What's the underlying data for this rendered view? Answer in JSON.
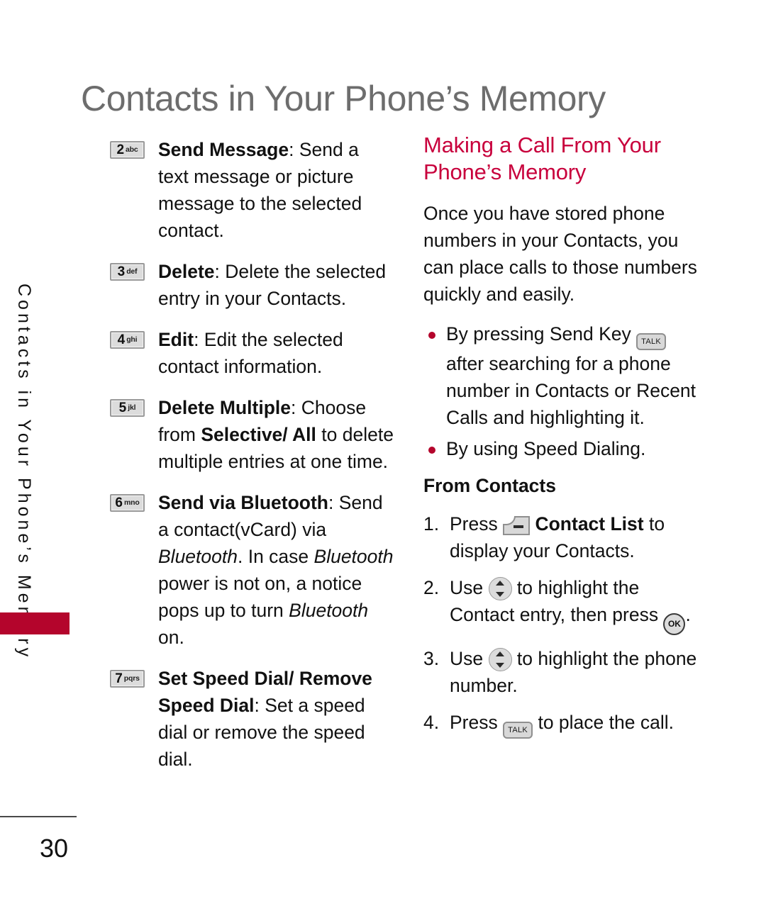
{
  "page": {
    "title": "Contacts in Your Phone’s Memory",
    "side_tab_label": "Contacts in Your Phone’s Memory",
    "number": "30",
    "accent_red": "#b4052c",
    "heading_red": "#c8003c",
    "title_gray": "#6d6d6d"
  },
  "left_column": {
    "items": [
      {
        "key_number": "2",
        "key_letters": "abc",
        "icon": "keypad-key-2-icon",
        "title": "Send Message",
        "body": ": Send a text message or picture message to the selected contact."
      },
      {
        "key_number": "3",
        "key_letters": "def",
        "icon": "keypad-key-3-icon",
        "title": "Delete",
        "body": ": Delete the selected entry in your Contacts."
      },
      {
        "key_number": "4",
        "key_letters": "ghi",
        "icon": "keypad-key-4-icon",
        "title": "Edit",
        "body": ": Edit the selected contact information."
      },
      {
        "key_number": "5",
        "key_letters": "jkl",
        "icon": "keypad-key-5-icon",
        "title": "Delete Multiple",
        "body_part1": ": Choose from ",
        "emph1": "Selective/ All",
        "body_part2": " to delete multiple entries at one time."
      },
      {
        "key_number": "6",
        "key_letters": "mno",
        "icon": "keypad-key-6-icon",
        "title": "Send via Bluetooth",
        "body_part1": ": Send a contact(vCard) via ",
        "italic1": "Bluetooth",
        "body_part2": ". In case ",
        "italic2": "Bluetooth",
        "body_part3": " power is not on, a notice pops up to turn ",
        "italic3": "Bluetooth",
        "body_part4": " on."
      },
      {
        "key_number": "7",
        "key_letters": "pqrs",
        "icon": "keypad-key-7-icon",
        "title": "Set Speed Dial/ Remove Speed Dial",
        "body": ": Set a speed dial or remove the speed dial."
      }
    ]
  },
  "right_column": {
    "heading": "Making a Call From Your Phone’s Memory",
    "intro": "Once you have stored phone numbers in your Contacts, you can place calls to those numbers quickly and easily.",
    "bullets": [
      {
        "text_before": "By pressing Send Key ",
        "icon": "talk-key-icon",
        "icon_label": "TALK",
        "text_after": " after searching for a phone number in Contacts or Recent Calls and highlighting it."
      },
      {
        "text_before": "By using Speed Dialing.",
        "icon": null,
        "icon_label": "",
        "text_after": ""
      }
    ],
    "sub_heading": "From Contacts",
    "steps": [
      {
        "text_before": "Press ",
        "icon": "soft-key-icon",
        "bold_text": "Contact List",
        "text_after": " to display your Contacts."
      },
      {
        "text_before": "Use ",
        "icon": "nav-updown-key-icon",
        "text_mid": " to highlight the Contact entry, then press ",
        "icon2": "ok-key-icon",
        "icon2_label": "OK",
        "text_after": "."
      },
      {
        "text_before": "Use ",
        "icon": "nav-updown-key-icon",
        "text_after": " to highlight the phone number."
      },
      {
        "text_before": "Press ",
        "icon": "talk-key-icon",
        "icon_label": "TALK",
        "text_after": " to place the call."
      }
    ]
  }
}
